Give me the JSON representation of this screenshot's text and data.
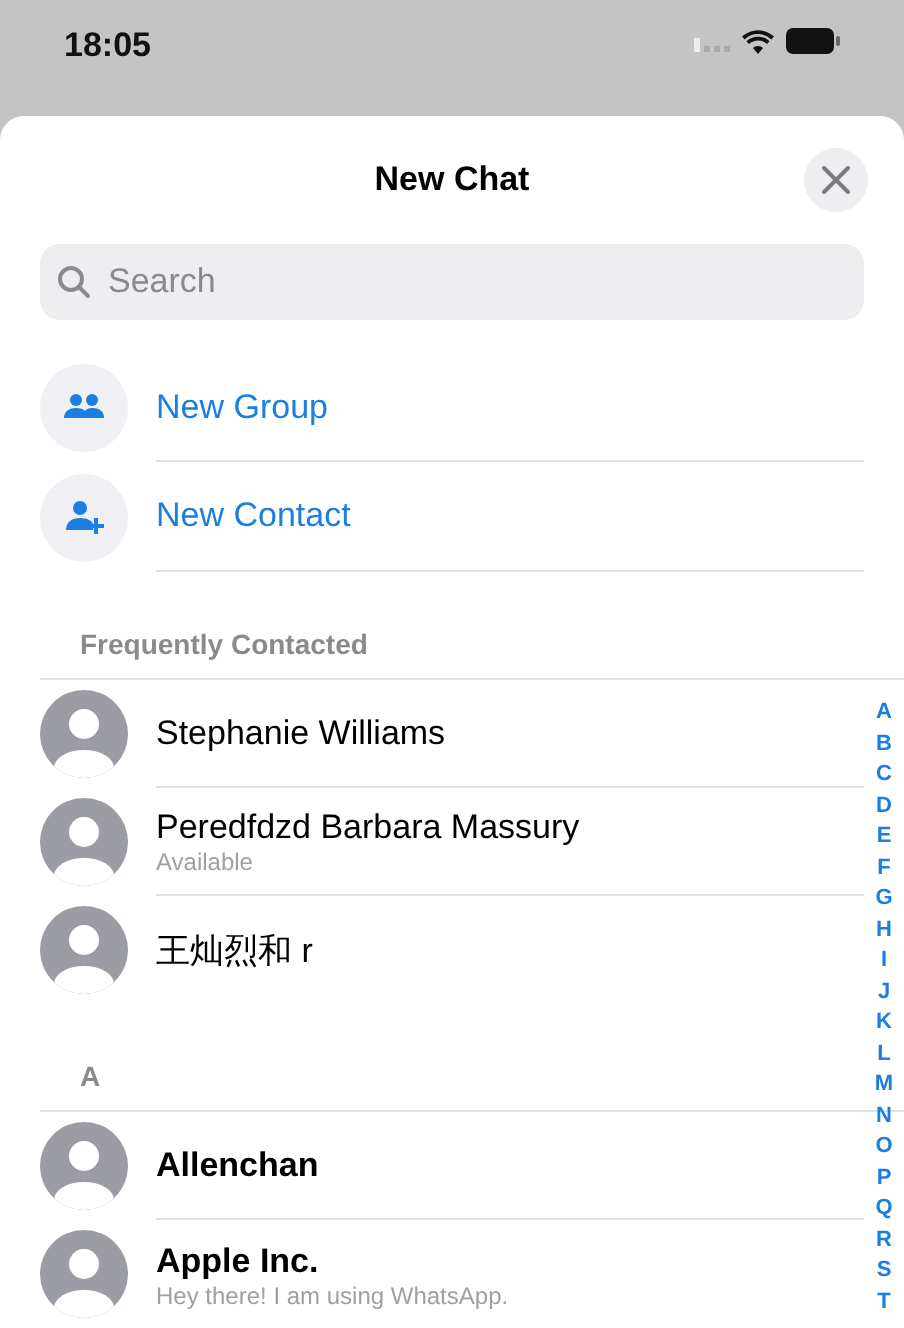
{
  "status_bar": {
    "time": "18:05"
  },
  "header": {
    "title": "New Chat"
  },
  "search": {
    "placeholder": "Search"
  },
  "actions": [
    {
      "kind": "group",
      "label": "New Group"
    },
    {
      "kind": "contact",
      "label": "New Contact"
    }
  ],
  "sections": [
    {
      "title": "Frequently Contacted",
      "contacts": [
        {
          "name": "Stephanie Williams",
          "bold": false
        },
        {
          "name": "Peredfdzd Barbara Massury",
          "status": "Available",
          "bold": false
        },
        {
          "name": "王灿烈和 r",
          "bold": false
        }
      ]
    },
    {
      "title": "A",
      "contacts": [
        {
          "name": "Allenchan",
          "bold": true
        },
        {
          "name": "Apple Inc.",
          "status": "Hey there! I am using WhatsApp.",
          "bold": true
        }
      ]
    }
  ],
  "index": [
    "A",
    "B",
    "C",
    "D",
    "E",
    "F",
    "G",
    "H",
    "I",
    "J",
    "K",
    "L",
    "M",
    "N",
    "O",
    "P",
    "Q",
    "R",
    "S",
    "T"
  ]
}
